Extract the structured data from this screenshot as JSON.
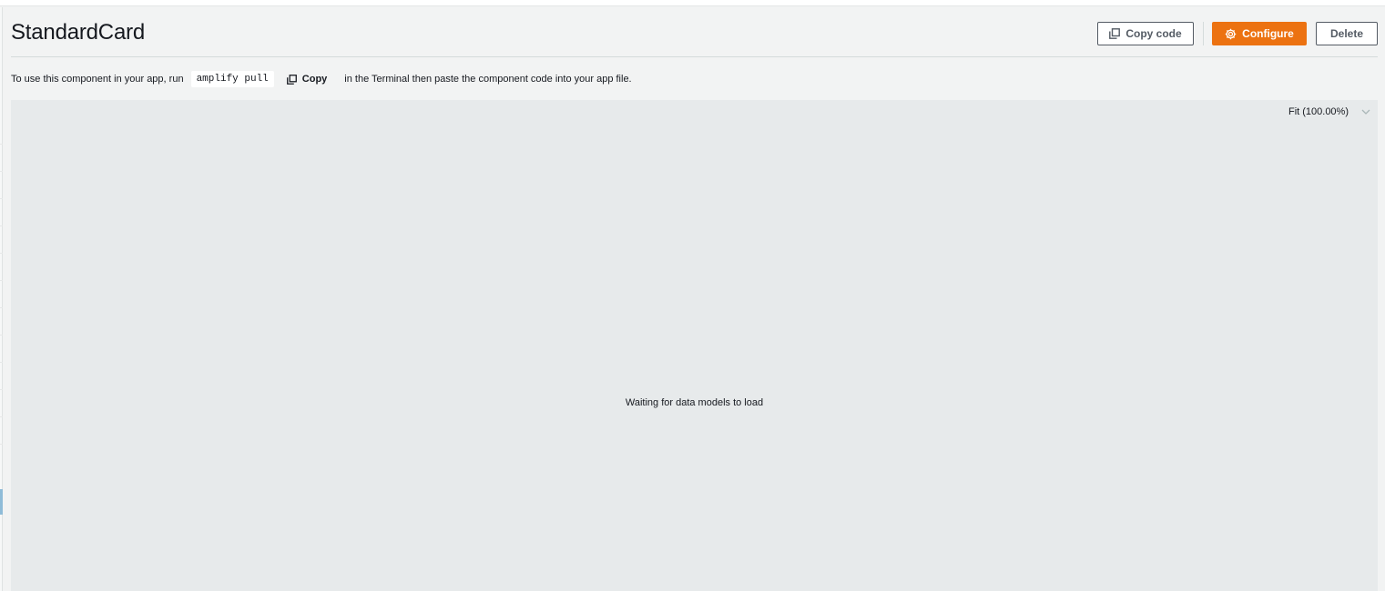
{
  "header": {
    "title": "StandardCard",
    "copy_code_label": "Copy code",
    "configure_label": "Configure",
    "delete_label": "Delete"
  },
  "instructions": {
    "prefix": "To use this component in your app, run",
    "command": "amplify pull",
    "copy_label": "Copy",
    "suffix": "in the Terminal then paste the component code into your app file."
  },
  "canvas": {
    "zoom_label": "Fit (100.00%)",
    "status_message": "Waiting for data models to load"
  },
  "colors": {
    "primary": "#ec7211",
    "secondary_border": "#545b64",
    "canvas_bg": "#e7eaeb"
  },
  "icons": {
    "copy": "copy-icon",
    "configure": "gear-icon",
    "zoom_dropdown": "chevron-down-icon"
  }
}
